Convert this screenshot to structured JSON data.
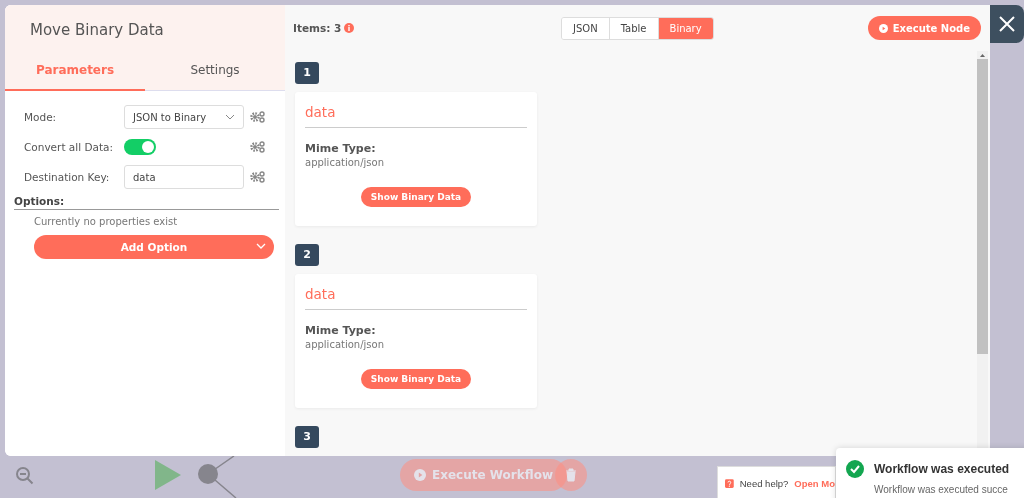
{
  "panel": {
    "title": "Move Binary Data",
    "tabs": [
      {
        "label": "Parameters",
        "selected": true
      },
      {
        "label": "Settings",
        "selected": false
      }
    ],
    "params": [
      {
        "kind": "select",
        "label": "Mode:",
        "value": "JSON to Binary"
      },
      {
        "kind": "toggle",
        "label": "Convert all Data:",
        "on": true
      },
      {
        "kind": "text",
        "label": "Destination Key:",
        "value": "data"
      }
    ],
    "options": {
      "label": "Options:",
      "empty_text": "Currently no properties exist",
      "add_button": "Add Option"
    }
  },
  "output": {
    "items_label": "Items: 3",
    "views": [
      {
        "label": "JSON",
        "selected": false
      },
      {
        "label": "Table",
        "selected": false
      },
      {
        "label": "Binary",
        "selected": true
      }
    ],
    "execute_button": "Execute Node",
    "items": [
      {
        "index": "1",
        "name": "data",
        "mime_label": "Mime Type:",
        "mime": "application/json",
        "button": "Show Binary Data"
      },
      {
        "index": "2",
        "name": "data",
        "mime_label": "Mime Type:",
        "mime": "application/json",
        "button": "Show Binary Data"
      },
      {
        "index": "3"
      }
    ]
  },
  "canvas": {
    "execute_button": "Execute Workflow",
    "help_text": "Need help?",
    "help_link": "Open Mo"
  },
  "toast": {
    "title": "Workflow was executed",
    "message": "Workflow was executed succe"
  }
}
